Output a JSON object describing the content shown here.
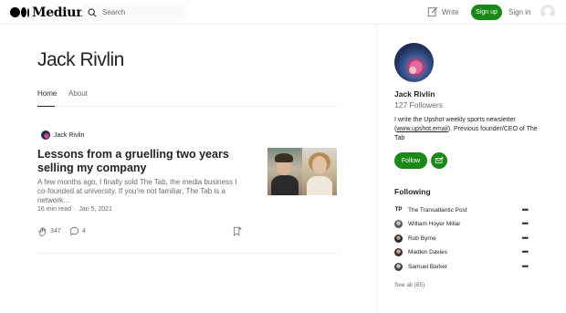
{
  "header": {
    "logo_text": "Medium",
    "search_placeholder": "Search",
    "write_label": "Write",
    "signup_label": "Sign up",
    "signin_label": "Sign in"
  },
  "profile": {
    "name": "Jack Rivlin",
    "tabs": [
      {
        "label": "Home",
        "active": true
      },
      {
        "label": "About",
        "active": false
      }
    ]
  },
  "post": {
    "author": "Jack Rivlin",
    "title": "Lessons from a gruelling two years selling my company",
    "excerpt": "A few months ago, I finally sold The Tab, the media business I co-founded at university. If you’re not familiar, The Tab is a network…",
    "read_time": "16 min read",
    "separator": "·",
    "date": "Jan 5, 2021",
    "claps": "347",
    "responses": "4"
  },
  "sidebar": {
    "name": "Jack Rivlin",
    "followers": "127 Followers",
    "bio_before": "I write the Upshot weekly sports newsletter (",
    "bio_link": "www.upshot.email",
    "bio_after": "). Previous founder/CEO of The Tab",
    "follow_label": "Follow",
    "following_heading": "Following",
    "following": [
      {
        "name": "The Transatlantic Post",
        "avatar": "TP"
      },
      {
        "name": "William Hoyer Millar",
        "avatar": ""
      },
      {
        "name": "Rob Byrne",
        "avatar": ""
      },
      {
        "name": "Madlen Davies",
        "avatar": ""
      },
      {
        "name": "Samuel Barker",
        "avatar": ""
      }
    ],
    "more_glyph": "•••",
    "see_all": "See all (85)"
  },
  "colors": {
    "accent_green": "#1a8917",
    "text_primary": "#242424",
    "text_secondary": "#6b6b6b"
  },
  "icons": [
    "medium-logo-icon",
    "search-icon",
    "write-icon",
    "user-avatar-icon",
    "clap-icon",
    "response-icon",
    "bookmark-icon",
    "subscribe-mail-icon",
    "more-icon"
  ]
}
